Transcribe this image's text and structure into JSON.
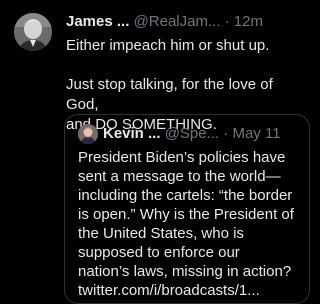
{
  "tweet": {
    "author_name": "James ...",
    "handle": "@RealJam...",
    "separator": "·",
    "time": "12m",
    "lines": [
      "Either impeach him or shut up.",
      "Just stop talking, for the love of God,",
      "and DO SOMETHING."
    ]
  },
  "quoted_tweet": {
    "author_name": "Kevin ...",
    "handle": "@Spe...",
    "separator": "·",
    "time": "May 11",
    "lines": [
      "President Biden’s policies have",
      "sent a message to the world—",
      "including the cartels: “the border",
      "is open.”  Why is the President of",
      "the United States, who is",
      "supposed to enforce our",
      "nation’s laws, missing in action?",
      "twitter.com/i/broadcasts/1..."
    ]
  },
  "colors": {
    "background": "#000000",
    "text_primary": "#e7e9ea",
    "text_secondary": "#71767b",
    "border": "#2f3336"
  }
}
